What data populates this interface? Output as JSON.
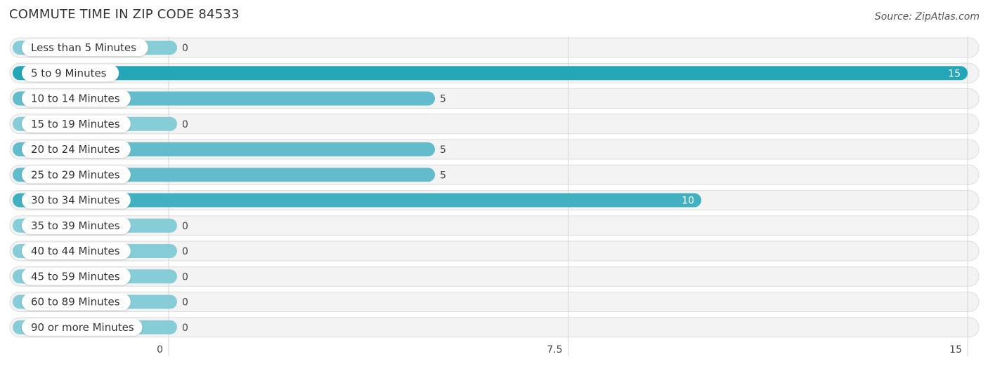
{
  "header": {
    "title": "COMMUTE TIME IN ZIP CODE 84533",
    "source": "Source: ZipAtlas.com"
  },
  "chart_data": {
    "type": "bar",
    "orientation": "horizontal",
    "title": "COMMUTE TIME IN ZIP CODE 84533",
    "categories": [
      "Less than 5 Minutes",
      "5 to 9 Minutes",
      "10 to 14 Minutes",
      "15 to 19 Minutes",
      "20 to 24 Minutes",
      "25 to 29 Minutes",
      "30 to 34 Minutes",
      "35 to 39 Minutes",
      "40 to 44 Minutes",
      "45 to 59 Minutes",
      "60 to 89 Minutes",
      "90 or more Minutes"
    ],
    "values": [
      0,
      15,
      5,
      0,
      5,
      5,
      10,
      0,
      0,
      0,
      0,
      0
    ],
    "xlim": [
      0,
      15
    ],
    "xticks": [
      0,
      7.5,
      15
    ],
    "xtick_labels": [
      "0",
      "7.5",
      "15"
    ],
    "grid": true,
    "xlabel": "",
    "ylabel": "",
    "colors": {
      "max": "#23a6b8",
      "high": "#41b1c2",
      "normal": "#62bccb",
      "zero": "#86cdd7",
      "track": "#f3f3f3"
    }
  }
}
